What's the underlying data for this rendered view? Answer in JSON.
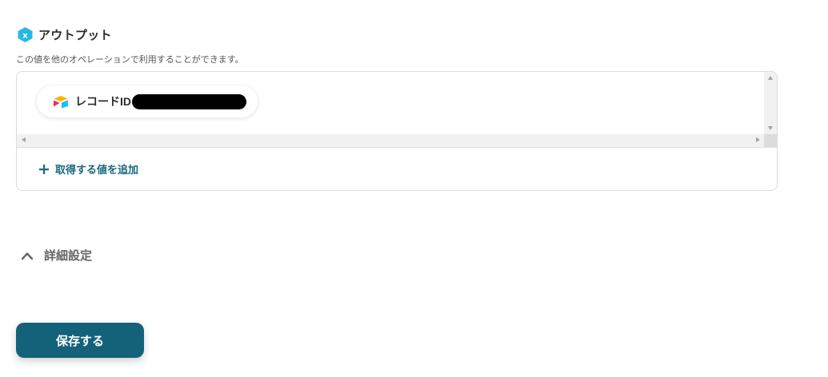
{
  "output": {
    "icon": "hexagon-x-icon",
    "icon_letter": "x",
    "title": "アウトプット",
    "description": "この値を他のオペレーションで利用することができます。",
    "chips": [
      {
        "icon": "airtable-icon",
        "label": "レコードID"
      }
    ],
    "add_value_label": "取得する値を追加"
  },
  "advanced": {
    "icon": "chevron-up-icon",
    "label": "詳細設定"
  },
  "footer": {
    "save_label": "保存する"
  },
  "colors": {
    "accent": "#13627a",
    "link": "#186a7f",
    "icon_cyan": "#27b8e3",
    "text": "#2b2b2b",
    "muted": "#666666"
  }
}
